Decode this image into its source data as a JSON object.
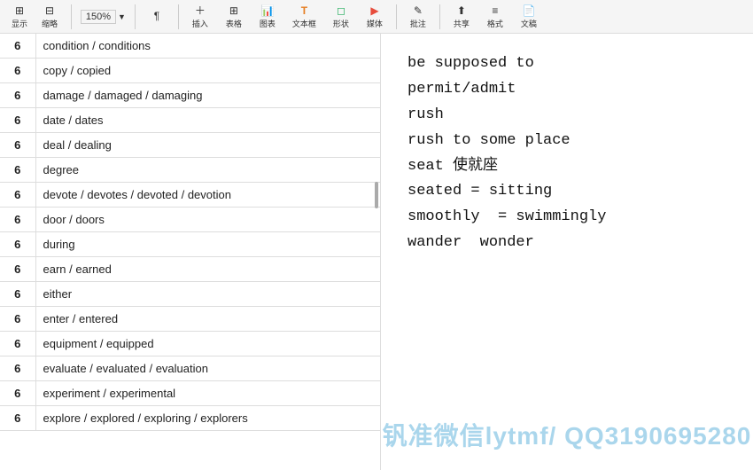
{
  "toolbar": {
    "zoom_value": "150%",
    "buttons": [
      {
        "label": "显示",
        "icon": "⊞"
      },
      {
        "label": "缩略",
        "icon": "⊟"
      },
      {
        "label": "插入",
        "icon": "＋"
      },
      {
        "label": "表格",
        "icon": "⊞"
      },
      {
        "label": "图表",
        "icon": "📊"
      },
      {
        "label": "文本框",
        "icon": "T"
      },
      {
        "label": "形状",
        "icon": "◻"
      },
      {
        "label": "媒体",
        "icon": "▶"
      },
      {
        "label": "批注",
        "icon": "✎"
      },
      {
        "label": "共享",
        "icon": "⬆"
      },
      {
        "label": "格式",
        "icon": "≡"
      },
      {
        "label": "文稿",
        "icon": "📄"
      }
    ]
  },
  "table": {
    "rows": [
      {
        "level": "6",
        "term": "condition / conditions"
      },
      {
        "level": "6",
        "term": "copy / copied"
      },
      {
        "level": "6",
        "term": "damage / damaged / damaging"
      },
      {
        "level": "6",
        "term": "date / dates"
      },
      {
        "level": "6",
        "term": "deal / dealing"
      },
      {
        "level": "6",
        "term": "degree"
      },
      {
        "level": "6",
        "term": "devote / devotes / devoted / devotion",
        "has_scroll": true
      },
      {
        "level": "6",
        "term": "door / doors"
      },
      {
        "level": "6",
        "term": "during"
      },
      {
        "level": "6",
        "term": "earn / earned"
      },
      {
        "level": "6",
        "term": "either"
      },
      {
        "level": "6",
        "term": "enter / entered"
      },
      {
        "level": "6",
        "term": "equipment / equipped"
      },
      {
        "level": "6",
        "term": "evaluate / evaluated / evaluation"
      },
      {
        "level": "6",
        "term": "experiment / experimental"
      },
      {
        "level": "6",
        "term": "explore / explored / exploring / explorers"
      }
    ]
  },
  "document": {
    "lines": [
      "be supposed to",
      "permit/admit",
      "rush",
      "rush to some place",
      "seat 使就座",
      "seated = sitting",
      "smoothly  = swimmingly",
      "wander  wonder"
    ]
  },
  "watermark": {
    "text": "钒准微信lytmf/  QQ3190695280"
  }
}
